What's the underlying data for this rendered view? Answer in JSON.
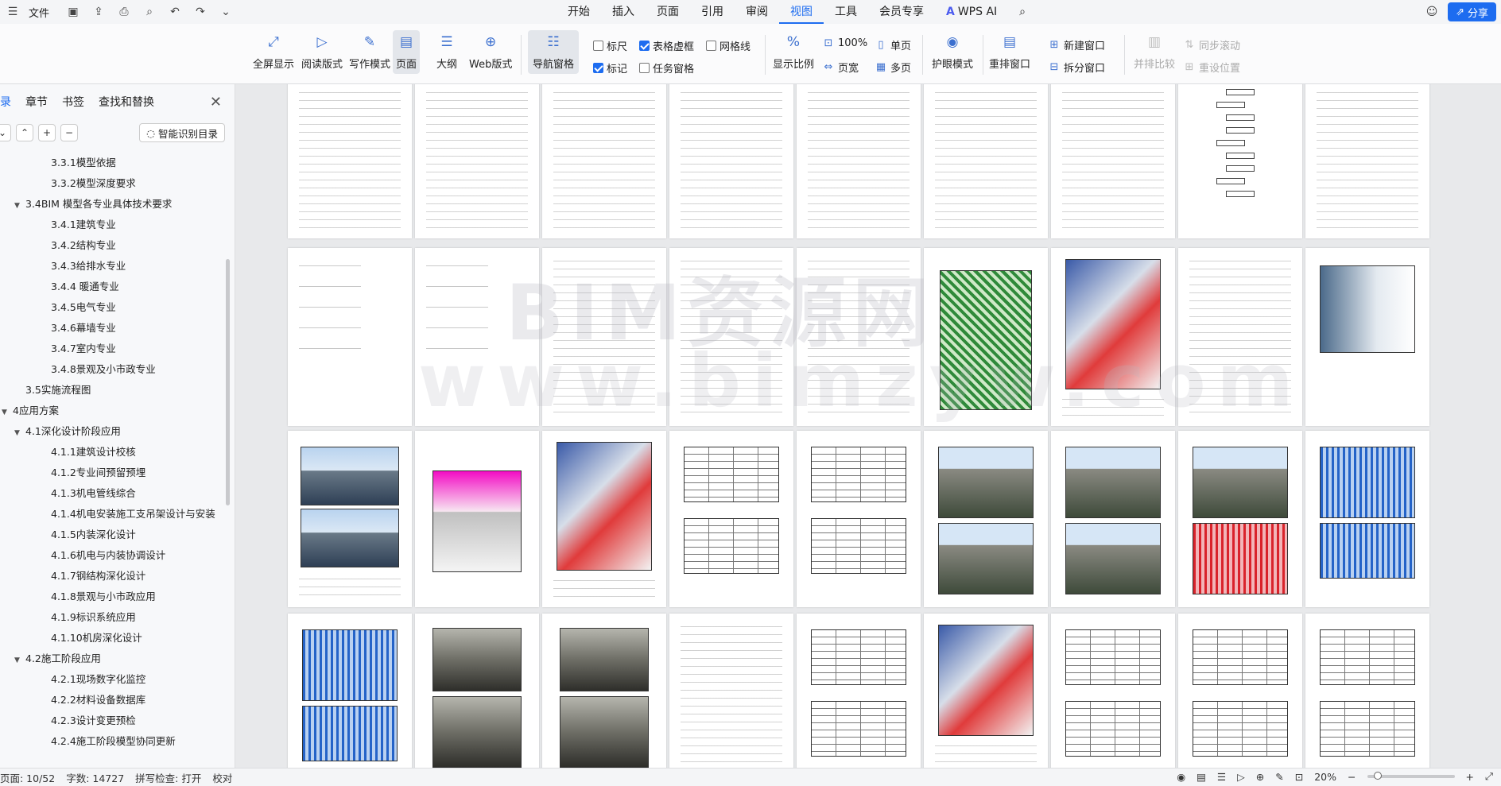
{
  "menubar": {
    "file_label": "文件",
    "tabs": [
      "开始",
      "插入",
      "页面",
      "引用",
      "审阅",
      "视图",
      "工具",
      "会员专享",
      "WPS AI"
    ],
    "active_tab": "视图",
    "share_label": "分享"
  },
  "ribbon": {
    "fullscreen": "全屏显示",
    "reading": "阅读版式",
    "writing": "写作模式",
    "page": "页面",
    "outline": "大纲",
    "web": "Web版式",
    "nav_pane": "导航窗格",
    "ruler": "标尺",
    "table_gridlines": "表格虚框",
    "gridlines": "网格线",
    "marks": "标记",
    "task_pane": "任务窗格",
    "zoom_ratio": "显示比例",
    "zoom_100": "100%",
    "page_width": "页宽",
    "single_page": "单页",
    "multi_page": "多页",
    "eye_mode": "护眼模式",
    "rearrange": "重排窗口",
    "new_window": "新建窗口",
    "split_window": "拆分窗口",
    "side_by_side": "并排比较",
    "sync_scroll": "同步滚动",
    "reset_position": "重设位置",
    "checks": {
      "ruler": false,
      "table_gridlines": true,
      "gridlines": false,
      "marks": true,
      "task_pane": false
    }
  },
  "navpane": {
    "tabs": [
      "目录",
      "章节",
      "书签",
      "查找和替换"
    ],
    "active_tab": "目录",
    "smart_toc": "智能识别目录",
    "items": [
      {
        "label": "3.3.1模型依据",
        "level": 3,
        "arrow": ""
      },
      {
        "label": "3.3.2模型深度要求",
        "level": 3,
        "arrow": ""
      },
      {
        "label": "3.4BIM 模型各专业具体技术要求",
        "level": 2,
        "arrow": "▼"
      },
      {
        "label": "3.4.1建筑专业",
        "level": 3,
        "arrow": ""
      },
      {
        "label": "3.4.2结构专业",
        "level": 3,
        "arrow": ""
      },
      {
        "label": "3.4.3给排水专业",
        "level": 3,
        "arrow": ""
      },
      {
        "label": "3.4.4  暖通专业",
        "level": 3,
        "arrow": ""
      },
      {
        "label": "3.4.5电气专业",
        "level": 3,
        "arrow": ""
      },
      {
        "label": "3.4.6幕墙专业",
        "level": 3,
        "arrow": ""
      },
      {
        "label": "3.4.7室内专业",
        "level": 3,
        "arrow": ""
      },
      {
        "label": "3.4.8景观及小市政专业",
        "level": 3,
        "arrow": ""
      },
      {
        "label": "3.5实施流程图",
        "level": 2,
        "arrow": ""
      },
      {
        "label": "4应用方案",
        "level": 1,
        "arrow": "▼"
      },
      {
        "label": "4.1深化设计阶段应用",
        "level": 2,
        "arrow": "▼"
      },
      {
        "label": "4.1.1建筑设计校核",
        "level": 3,
        "arrow": ""
      },
      {
        "label": "4.1.2专业间预留预埋",
        "level": 3,
        "arrow": ""
      },
      {
        "label": "4.1.3机电管线综合",
        "level": 3,
        "arrow": ""
      },
      {
        "label": "4.1.4机电安装施工支吊架设计与安装",
        "level": 3,
        "arrow": ""
      },
      {
        "label": "4.1.5内装深化设计",
        "level": 3,
        "arrow": ""
      },
      {
        "label": "4.1.6机电与内装协调设计",
        "level": 3,
        "arrow": ""
      },
      {
        "label": "4.1.7钢结构深化设计",
        "level": 3,
        "arrow": ""
      },
      {
        "label": "4.1.8景观与小市政应用",
        "level": 3,
        "arrow": ""
      },
      {
        "label": "4.1.9标识系统应用",
        "level": 3,
        "arrow": ""
      },
      {
        "label": "4.1.10机房深化设计",
        "level": 3,
        "arrow": ""
      },
      {
        "label": "4.2施工阶段应用",
        "level": 2,
        "arrow": "▼"
      },
      {
        "label": "4.2.1现场数字化监控",
        "level": 3,
        "arrow": ""
      },
      {
        "label": "4.2.2材料设备数据库",
        "level": 3,
        "arrow": ""
      },
      {
        "label": "4.2.3设计变更预检",
        "level": 3,
        "arrow": ""
      },
      {
        "label": "4.2.4施工阶段模型协同更新",
        "level": 3,
        "arrow": ""
      }
    ]
  },
  "document": {
    "watermark_cn": "BIM资源网",
    "watermark_en": "www.bimzyw.com"
  },
  "statusbar": {
    "page_info": "页面: 10/52",
    "word_count": "字数: 14727",
    "spell_check": "拼写检查: 打开",
    "proofread": "校对",
    "zoom": "20%"
  }
}
